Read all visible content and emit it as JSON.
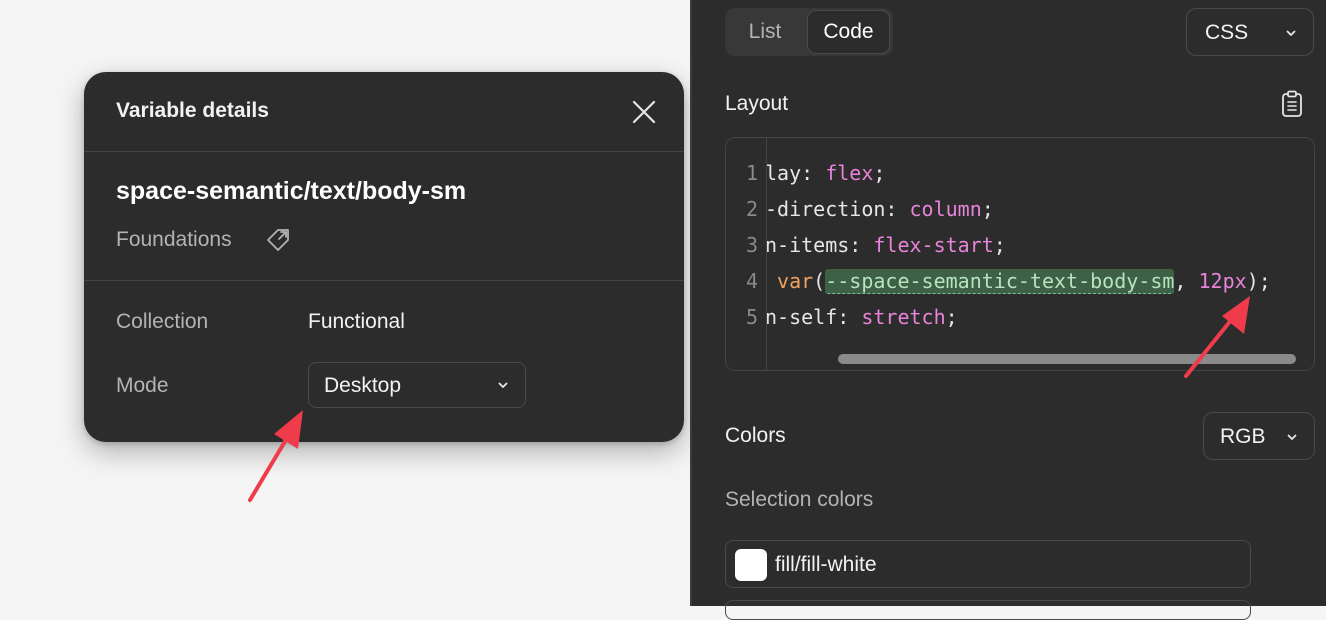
{
  "popover": {
    "title": "Variable details",
    "variable_name": "space-semantic/text/body-sm",
    "library": "Foundations",
    "collection_label": "Collection",
    "collection_value": "Functional",
    "mode_label": "Mode",
    "mode_value": "Desktop"
  },
  "panel": {
    "tabs": [
      {
        "label": "List"
      },
      {
        "label": "Code"
      }
    ],
    "language": "CSS",
    "layout_title": "Layout",
    "code": {
      "line_numbers": [
        "1",
        "2",
        "3",
        "4",
        "5"
      ],
      "lines": [
        [
          "lay: ",
          "flex",
          ";"
        ],
        [
          "-direction: ",
          "column",
          ";"
        ],
        [
          "n-items: ",
          "flex-start",
          ";"
        ],
        [
          " ",
          "var",
          "(",
          "--space-semantic-text-body-sm",
          ", ",
          "12px",
          ");"
        ],
        [
          "n-self: ",
          "stretch",
          ";"
        ]
      ]
    },
    "colors_title": "Colors",
    "color_format": "RGB",
    "selection_colors_title": "Selection colors",
    "selection_colors": [
      {
        "name": "fill/fill-white",
        "hex": "#ffffff"
      }
    ]
  },
  "theme": {
    "panel_bg": "#2c2c2c",
    "page_bg": "#f5f5f5",
    "annotation_arrow": "#ef3b4a",
    "keyword": "#e884d9",
    "function": "#f0a35e",
    "variable_highlight": "#3d6046"
  }
}
